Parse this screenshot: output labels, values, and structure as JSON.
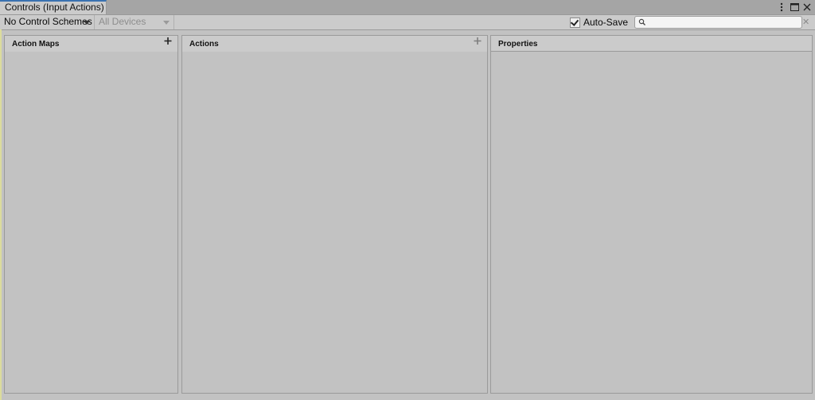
{
  "window": {
    "tab_title": "Controls (Input Actions)",
    "controls": [
      "more-options-icon",
      "maximize-icon",
      "close-icon"
    ]
  },
  "toolbar": {
    "control_scheme": "No Control Schemes",
    "devices": "All Devices",
    "autosave_label": "Auto-Save",
    "autosave_checked": true,
    "search_value": "",
    "search_placeholder": ""
  },
  "panels": {
    "action_maps": {
      "title": "Action Maps",
      "add_enabled": true
    },
    "actions": {
      "title": "Actions",
      "add_enabled": false
    },
    "properties": {
      "title": "Properties"
    }
  },
  "colors": {
    "background": "#c2c2c2",
    "header": "#cbcbcb",
    "tab_accent": "#3a72b0"
  }
}
